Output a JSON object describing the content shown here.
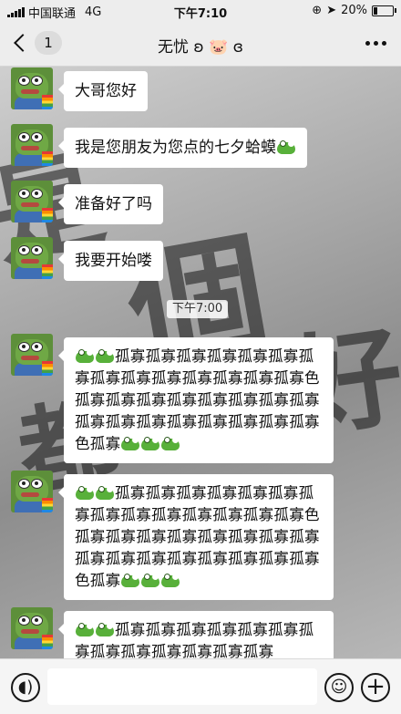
{
  "status_bar": {
    "carrier": "中国联通",
    "network": "4G",
    "time": "下午7:10",
    "battery_text": "20%",
    "battery_level": 0.2
  },
  "nav": {
    "back_count": "1",
    "title": "无忧 ʚ 🐷 ɞ"
  },
  "messages": [
    {
      "text": "大哥您好"
    },
    {
      "text": "我是您朋友为您点的七夕蛤蟆"
    },
    {
      "text": "准备好了吗"
    },
    {
      "text": "我要开始喽"
    }
  ],
  "time_divider": "下午7:00",
  "long_messages": [
    {
      "text": "孤寡孤寡孤寡孤寡孤寡孤寡孤寡孤寡孤寡孤寡孤寡孤寡孤寡孤寡色孤寡孤寡孤寡孤寡孤寡孤寡孤寡孤寡孤寡孤寡孤寡孤寡孤寡孤寡孤寡孤寡色孤寡",
      "lead_frogs": 2,
      "tail_frogs": 3
    },
    {
      "text": "孤寡孤寡孤寡孤寡孤寡孤寡孤寡孤寡孤寡孤寡孤寡孤寡孤寡孤寡色孤寡孤寡孤寡孤寡孤寡孤寡孤寡孤寡孤寡孤寡孤寡孤寡孤寡孤寡孤寡孤寡色孤寡",
      "lead_frogs": 2,
      "tail_frogs": 3
    },
    {
      "text": "孤寡孤寡孤寡孤寡孤寡孤寡孤寡孤寡孤寡孤寡孤寡孤寡孤寡",
      "lead_frogs": 2,
      "tail_frogs": 0
    }
  ],
  "icons": {
    "avatar": "pepe-frog-avatar",
    "frog_emoji": "frog-emoji-icon",
    "voice": "voice-icon",
    "emoji": "smiley-icon",
    "plus": "plus-icon"
  }
}
